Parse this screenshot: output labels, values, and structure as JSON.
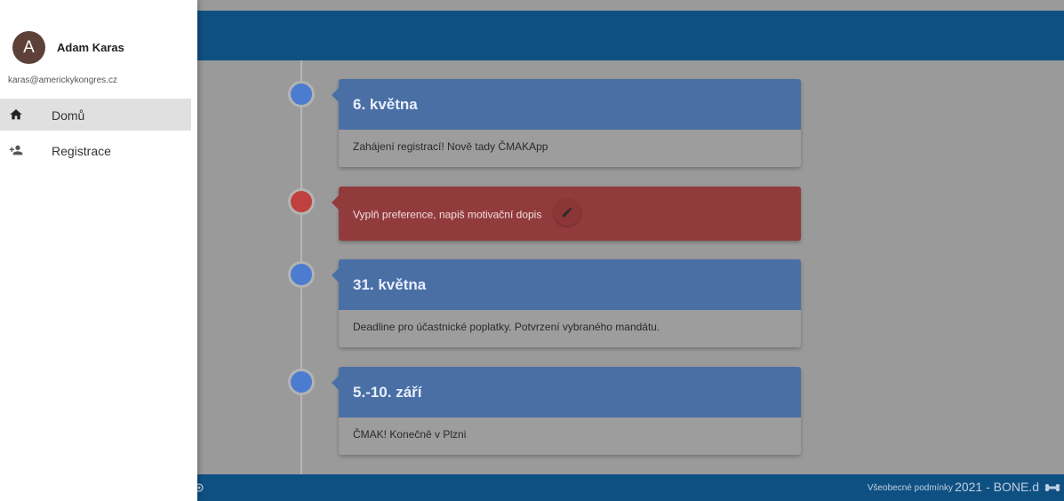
{
  "user": {
    "initial": "A",
    "name": "Adam Karas",
    "email": "karas@americkykongres.cz"
  },
  "nav": {
    "items": [
      {
        "label": "Domů",
        "icon": "home-icon",
        "active": true
      },
      {
        "label": "Registrace",
        "icon": "person-add-icon",
        "active": false
      }
    ]
  },
  "timeline": {
    "events": [
      {
        "date": "6. května",
        "text": "Zahájení registrací! Nově tady ČMAKApp"
      },
      {
        "text": "Vyplň preference, napiš motivační dopis",
        "action_icon": "edit-icon"
      },
      {
        "date": "31. května",
        "text": "Deadline pro účastnické poplatky. Potvrzení vybraného mandátu."
      },
      {
        "date": "5.-10. září",
        "text": "ČMAK! Konečně v Plzni"
      }
    ]
  },
  "footer": {
    "terms": "Všeobecné podmínky",
    "brand": "2021 - BONE.d"
  },
  "colors": {
    "primary": "#0f5083",
    "card_blue": "#4a6fa5",
    "card_red": "#923b3c",
    "avatar": "#5d4037"
  }
}
